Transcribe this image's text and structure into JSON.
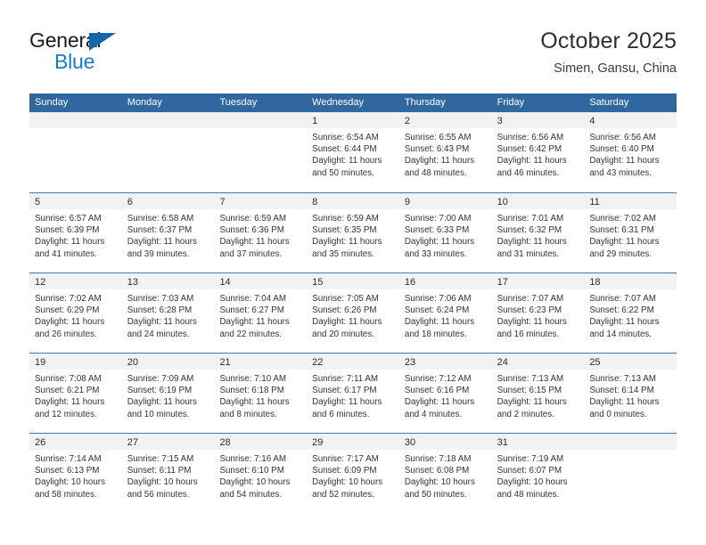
{
  "logo": {
    "text_primary": "General",
    "text_secondary": "Blue",
    "triangle_icon": "triangle-icon",
    "color_primary": "#1b1b1b",
    "color_secondary": "#1a7ac4"
  },
  "header": {
    "title": "October 2025",
    "subtitle": "Simen, Gansu, China"
  },
  "theme": {
    "header_bg": "#30679f",
    "week_divider": "#3b7cb8",
    "day_band_bg": "#f2f2f2",
    "text": "#333333"
  },
  "weekdays": [
    "Sunday",
    "Monday",
    "Tuesday",
    "Wednesday",
    "Thursday",
    "Friday",
    "Saturday"
  ],
  "weeks": [
    [
      {
        "day": "",
        "empty": true
      },
      {
        "day": "",
        "empty": true
      },
      {
        "day": "",
        "empty": true
      },
      {
        "day": "1",
        "sunrise": "Sunrise: 6:54 AM",
        "sunset": "Sunset: 6:44 PM",
        "daylight1": "Daylight: 11 hours",
        "daylight2": "and 50 minutes."
      },
      {
        "day": "2",
        "sunrise": "Sunrise: 6:55 AM",
        "sunset": "Sunset: 6:43 PM",
        "daylight1": "Daylight: 11 hours",
        "daylight2": "and 48 minutes."
      },
      {
        "day": "3",
        "sunrise": "Sunrise: 6:56 AM",
        "sunset": "Sunset: 6:42 PM",
        "daylight1": "Daylight: 11 hours",
        "daylight2": "and 46 minutes."
      },
      {
        "day": "4",
        "sunrise": "Sunrise: 6:56 AM",
        "sunset": "Sunset: 6:40 PM",
        "daylight1": "Daylight: 11 hours",
        "daylight2": "and 43 minutes."
      }
    ],
    [
      {
        "day": "5",
        "sunrise": "Sunrise: 6:57 AM",
        "sunset": "Sunset: 6:39 PM",
        "daylight1": "Daylight: 11 hours",
        "daylight2": "and 41 minutes."
      },
      {
        "day": "6",
        "sunrise": "Sunrise: 6:58 AM",
        "sunset": "Sunset: 6:37 PM",
        "daylight1": "Daylight: 11 hours",
        "daylight2": "and 39 minutes."
      },
      {
        "day": "7",
        "sunrise": "Sunrise: 6:59 AM",
        "sunset": "Sunset: 6:36 PM",
        "daylight1": "Daylight: 11 hours",
        "daylight2": "and 37 minutes."
      },
      {
        "day": "8",
        "sunrise": "Sunrise: 6:59 AM",
        "sunset": "Sunset: 6:35 PM",
        "daylight1": "Daylight: 11 hours",
        "daylight2": "and 35 minutes."
      },
      {
        "day": "9",
        "sunrise": "Sunrise: 7:00 AM",
        "sunset": "Sunset: 6:33 PM",
        "daylight1": "Daylight: 11 hours",
        "daylight2": "and 33 minutes."
      },
      {
        "day": "10",
        "sunrise": "Sunrise: 7:01 AM",
        "sunset": "Sunset: 6:32 PM",
        "daylight1": "Daylight: 11 hours",
        "daylight2": "and 31 minutes."
      },
      {
        "day": "11",
        "sunrise": "Sunrise: 7:02 AM",
        "sunset": "Sunset: 6:31 PM",
        "daylight1": "Daylight: 11 hours",
        "daylight2": "and 29 minutes."
      }
    ],
    [
      {
        "day": "12",
        "sunrise": "Sunrise: 7:02 AM",
        "sunset": "Sunset: 6:29 PM",
        "daylight1": "Daylight: 11 hours",
        "daylight2": "and 26 minutes."
      },
      {
        "day": "13",
        "sunrise": "Sunrise: 7:03 AM",
        "sunset": "Sunset: 6:28 PM",
        "daylight1": "Daylight: 11 hours",
        "daylight2": "and 24 minutes."
      },
      {
        "day": "14",
        "sunrise": "Sunrise: 7:04 AM",
        "sunset": "Sunset: 6:27 PM",
        "daylight1": "Daylight: 11 hours",
        "daylight2": "and 22 minutes."
      },
      {
        "day": "15",
        "sunrise": "Sunrise: 7:05 AM",
        "sunset": "Sunset: 6:26 PM",
        "daylight1": "Daylight: 11 hours",
        "daylight2": "and 20 minutes."
      },
      {
        "day": "16",
        "sunrise": "Sunrise: 7:06 AM",
        "sunset": "Sunset: 6:24 PM",
        "daylight1": "Daylight: 11 hours",
        "daylight2": "and 18 minutes."
      },
      {
        "day": "17",
        "sunrise": "Sunrise: 7:07 AM",
        "sunset": "Sunset: 6:23 PM",
        "daylight1": "Daylight: 11 hours",
        "daylight2": "and 16 minutes."
      },
      {
        "day": "18",
        "sunrise": "Sunrise: 7:07 AM",
        "sunset": "Sunset: 6:22 PM",
        "daylight1": "Daylight: 11 hours",
        "daylight2": "and 14 minutes."
      }
    ],
    [
      {
        "day": "19",
        "sunrise": "Sunrise: 7:08 AM",
        "sunset": "Sunset: 6:21 PM",
        "daylight1": "Daylight: 11 hours",
        "daylight2": "and 12 minutes."
      },
      {
        "day": "20",
        "sunrise": "Sunrise: 7:09 AM",
        "sunset": "Sunset: 6:19 PM",
        "daylight1": "Daylight: 11 hours",
        "daylight2": "and 10 minutes."
      },
      {
        "day": "21",
        "sunrise": "Sunrise: 7:10 AM",
        "sunset": "Sunset: 6:18 PM",
        "daylight1": "Daylight: 11 hours",
        "daylight2": "and 8 minutes."
      },
      {
        "day": "22",
        "sunrise": "Sunrise: 7:11 AM",
        "sunset": "Sunset: 6:17 PM",
        "daylight1": "Daylight: 11 hours",
        "daylight2": "and 6 minutes."
      },
      {
        "day": "23",
        "sunrise": "Sunrise: 7:12 AM",
        "sunset": "Sunset: 6:16 PM",
        "daylight1": "Daylight: 11 hours",
        "daylight2": "and 4 minutes."
      },
      {
        "day": "24",
        "sunrise": "Sunrise: 7:13 AM",
        "sunset": "Sunset: 6:15 PM",
        "daylight1": "Daylight: 11 hours",
        "daylight2": "and 2 minutes."
      },
      {
        "day": "25",
        "sunrise": "Sunrise: 7:13 AM",
        "sunset": "Sunset: 6:14 PM",
        "daylight1": "Daylight: 11 hours",
        "daylight2": "and 0 minutes."
      }
    ],
    [
      {
        "day": "26",
        "sunrise": "Sunrise: 7:14 AM",
        "sunset": "Sunset: 6:13 PM",
        "daylight1": "Daylight: 10 hours",
        "daylight2": "and 58 minutes."
      },
      {
        "day": "27",
        "sunrise": "Sunrise: 7:15 AM",
        "sunset": "Sunset: 6:11 PM",
        "daylight1": "Daylight: 10 hours",
        "daylight2": "and 56 minutes."
      },
      {
        "day": "28",
        "sunrise": "Sunrise: 7:16 AM",
        "sunset": "Sunset: 6:10 PM",
        "daylight1": "Daylight: 10 hours",
        "daylight2": "and 54 minutes."
      },
      {
        "day": "29",
        "sunrise": "Sunrise: 7:17 AM",
        "sunset": "Sunset: 6:09 PM",
        "daylight1": "Daylight: 10 hours",
        "daylight2": "and 52 minutes."
      },
      {
        "day": "30",
        "sunrise": "Sunrise: 7:18 AM",
        "sunset": "Sunset: 6:08 PM",
        "daylight1": "Daylight: 10 hours",
        "daylight2": "and 50 minutes."
      },
      {
        "day": "31",
        "sunrise": "Sunrise: 7:19 AM",
        "sunset": "Sunset: 6:07 PM",
        "daylight1": "Daylight: 10 hours",
        "daylight2": "and 48 minutes."
      },
      {
        "day": "",
        "empty": true
      }
    ]
  ]
}
